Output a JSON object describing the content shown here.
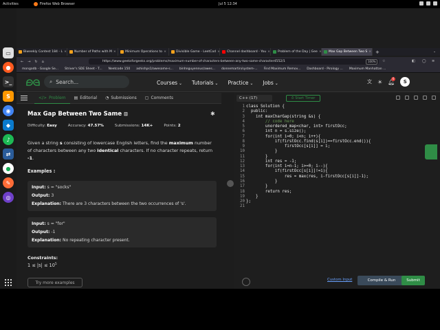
{
  "os": {
    "activities": "Activities",
    "browser_name": "Firefox Web Browser",
    "clock": "Jul 5  12:34"
  },
  "tabs": [
    {
      "label": "Biweekly Contest 184 - L",
      "color": "#f4a11b"
    },
    {
      "label": "Number of Paths with M",
      "color": "#f4a11b"
    },
    {
      "label": "Minimum Operations to",
      "color": "#f4a11b"
    },
    {
      "label": "Divisible Game - LeetCod",
      "color": "#f4a11b"
    },
    {
      "label": "Channel dashboard - You",
      "color": "#ff0000"
    },
    {
      "label": "Problem of the Day | Gee",
      "color": "#2f8d46"
    },
    {
      "label": "Max Gap Between Two S",
      "color": "#2f8d46"
    }
  ],
  "address": {
    "url": "https://www.geeksforgeeks.org/problems/maximum-number-of-characters-between-any-two-same-character4552/1",
    "zoom": "100%"
  },
  "bookmarks": [
    "mongodb - Google Se...",
    "Striver's SDE Sheet - T...",
    "Neetcode 150",
    "ashishps1/awesome-s...",
    "binhnguyennus/awes...",
    "donnemartin/system-...",
    "Find Maximum Remov...",
    "Dashboard - Pirology ...",
    "Maximum Manhattan ..."
  ],
  "nav": {
    "search_placeholder": "Search...",
    "links": [
      "Courses",
      "Tutorials",
      "Practice",
      "Jobs"
    ],
    "avatar_letter": "S",
    "notif": "6"
  },
  "subtabs": [
    "Problem",
    "Editorial",
    "Submissions",
    "Comments"
  ],
  "problem": {
    "title": "Max Gap Between Two Same",
    "difficulty_label": "Difficulty:",
    "difficulty": "Easy",
    "accuracy_label": "Accuracy:",
    "accuracy": "47.57%",
    "submissions_label": "Submissions:",
    "submissions": "14K+",
    "points_label": "Points:",
    "points": "2",
    "desc_1": "Given a string ",
    "desc_s": "s",
    "desc_2": " consisting of lowercase English letters, find the ",
    "desc_max": "maximum",
    "desc_3": " number of characters between any two ",
    "desc_identical": "identical",
    "desc_4": " characters. If no character repeats, return ",
    "desc_neg": "-1",
    "desc_5": ".",
    "examples_heading": "Examples :",
    "examples": [
      {
        "input": "s = \"socks\"",
        "output": "3",
        "explanation": "There are 3 characters between the two occurrences of 's'."
      },
      {
        "input": "s = \"for\"",
        "output": "-1",
        "explanation": "No repeating character present."
      }
    ],
    "input_label": "Input:",
    "output_label": "Output:",
    "explanation_label": "Explanation:",
    "constraints_heading": "Constraints:",
    "constraint": "1 ≤ |s| ≤ 10",
    "constraint_exp": "5",
    "try_more": "Try more examples"
  },
  "editor": {
    "language": "C++ (17)",
    "start_timer": "Start Timer",
    "line_numbers": [
      "1",
      "2",
      "3",
      "4",
      "5",
      "6",
      "7",
      "8",
      "9",
      "10",
      "11",
      "12",
      "13",
      "14",
      "15",
      "16",
      "17",
      "18",
      "19",
      "20",
      "21"
    ],
    "lines": [
      "class Solution {",
      "  public:",
      "    int maxCharGap(string &s) {",
      "        // code here",
      "        unordered_map<char, int> firstOcc;",
      "        int n = s.size();",
      "        for(int i=0; i<n; i++){",
      "            if(firstOcc.find(s[i])==firstOcc.end()){",
      "                firstOcc[s[i]] = i;",
      "            }",
      "        }",
      "        int res = -1;",
      "        for(int i=n-1; i>=0; i--){",
      "            if(firstOcc[s[i]]!=i){",
      "                res = max(res, i-firstOcc[s[i]]-1);",
      "            }",
      "        }",
      "        return res;",
      "    }",
      "};",
      ""
    ],
    "custom_input": "Custom Input",
    "compile_run": "Compile & Run",
    "submit": "Submit"
  },
  "colors": {
    "accent": "#2f8d46",
    "bg": "#1d1d1d"
  }
}
